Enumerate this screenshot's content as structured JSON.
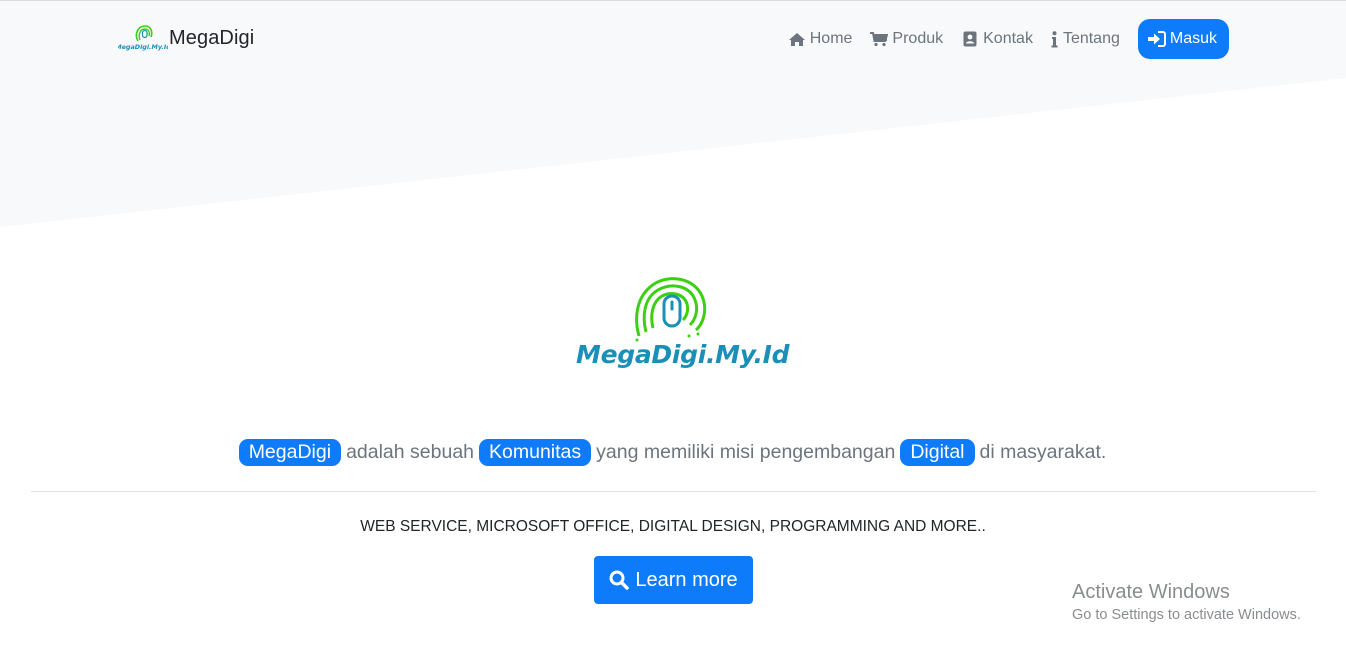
{
  "navbar": {
    "brand_text": "MegaDigi",
    "brand_logo_caption": "MegaDigi.My.Id",
    "links": [
      {
        "label": "Home",
        "icon": "home-icon"
      },
      {
        "label": "Produk",
        "icon": "shopping-cart-icon"
      },
      {
        "label": "Kontak",
        "icon": "address-book-icon"
      },
      {
        "label": "Tentang",
        "icon": "info-icon"
      }
    ],
    "login": {
      "label": "Masuk",
      "icon": "sign-in-icon"
    }
  },
  "hero": {
    "logo_text": "MegaDigi.My.Id",
    "lead": {
      "highlight_1": "MegaDigi",
      "text_1": "adalah sebuah",
      "highlight_2": "Komunitas",
      "text_2": "yang memiliki misi pengembangan",
      "highlight_3": "Digital",
      "text_3": "di masyarakat."
    },
    "tagline": "WEB SERVICE, MICROSOFT OFFICE, DIGITAL DESIGN, PROGRAMMING AND MORE..",
    "cta": {
      "label": "Learn more",
      "icon": "search-icon"
    }
  },
  "watermark": {
    "title": "Activate Windows",
    "subtitle": "Go to Settings to activate Windows."
  },
  "colors": {
    "primary": "#0d7bfa",
    "hero_background": "#f8f9fa",
    "muted_text": "#6c757d",
    "logo_green": "#3ccf12",
    "logo_blue": "#1a8fb8"
  }
}
